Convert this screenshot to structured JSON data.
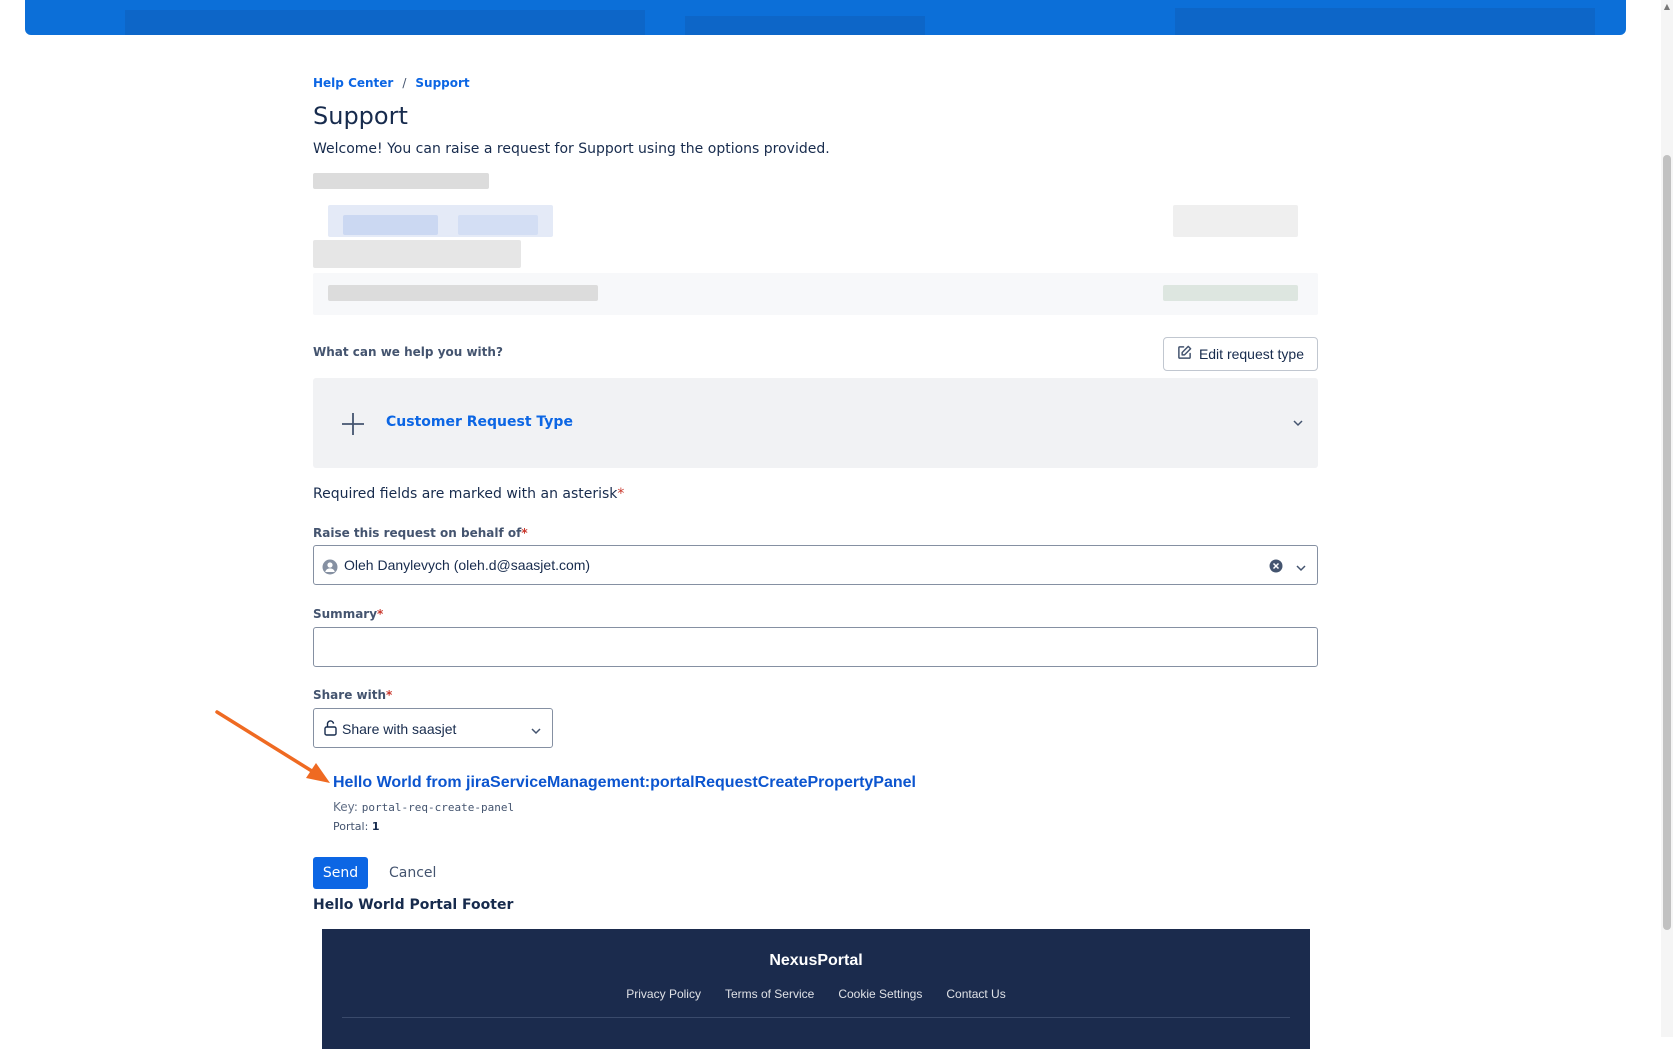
{
  "breadcrumb": {
    "home": "Help Center",
    "separator": "/",
    "current": "Support"
  },
  "page": {
    "title": "Support",
    "welcome": "Welcome! You can raise a request for Support using the options provided."
  },
  "request_type": {
    "prompt": "What can we help you with?",
    "edit_button": "Edit request type",
    "selected": "Customer Request Type"
  },
  "form": {
    "required_note": "Required fields are marked with an asterisk",
    "asterisk": "*",
    "on_behalf_label": "Raise this request on behalf of",
    "on_behalf_value": "Oleh Danylevych (oleh.d@saasjet.com)",
    "summary_label": "Summary",
    "summary_value": "",
    "share_label": "Share with",
    "share_value": "Share with saasjet"
  },
  "panel": {
    "title": "Hello World from jiraServiceManagement:portalRequestCreatePropertyPanel",
    "key_label": "Key:",
    "key_value": "portal-req-create-panel",
    "portal_label": "Portal:",
    "portal_value": "1"
  },
  "actions": {
    "send": "Send",
    "cancel": "Cancel"
  },
  "portal_footer": "Hello World Portal Footer",
  "site_footer": {
    "brand": "NexusPortal",
    "links": [
      "Privacy Policy",
      "Terms of Service",
      "Cookie Settings",
      "Contact Us"
    ]
  },
  "colors": {
    "banner": "#0c6fd8",
    "link": "#0c66e4",
    "primary_button": "#0c66e4",
    "footer_bg": "#1b2b4d",
    "annotation_arrow": "#ef6a22",
    "required_asterisk": "#c9372c"
  }
}
